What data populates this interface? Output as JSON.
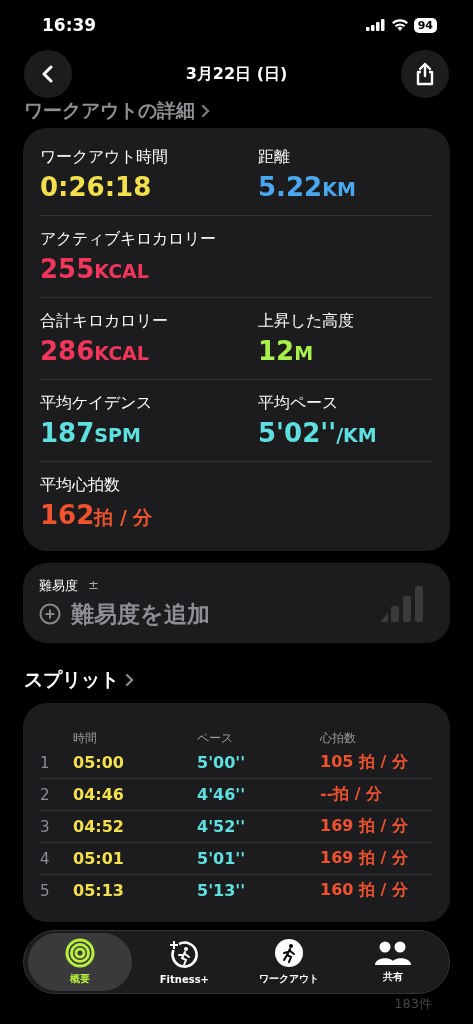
{
  "status_bar": {
    "time": "16:39",
    "battery": "94"
  },
  "nav": {
    "title": "3月22日 (日)"
  },
  "details": {
    "heading": "ワークアウトの詳細",
    "rows": [
      [
        {
          "label": "ワークアウト時間",
          "value": "0:26:18",
          "color": "#f4e04d"
        },
        {
          "label": "距離",
          "value": "5.22",
          "unit": "KM",
          "color": "#4aa8f0"
        }
      ],
      [
        {
          "label": "アクティブキロカロリー",
          "value": "255",
          "unit": "KCAL",
          "color": "#f0365a"
        }
      ],
      [
        {
          "label": "合計キロカロリー",
          "value": "286",
          "unit": "KCAL",
          "color": "#f0365a"
        },
        {
          "label": "上昇した高度",
          "value": "12",
          "unit": "M",
          "color": "#a8f04a"
        }
      ],
      [
        {
          "label": "平均ケイデンス",
          "value": "187",
          "unit": "SPM",
          "color": "#5ee0e0"
        },
        {
          "label": "平均ペース",
          "value": "5'02''",
          "unit": "/KM",
          "color": "#5ee0e0"
        }
      ],
      [
        {
          "label": "平均心拍数",
          "value": "162",
          "unit": "拍 / 分",
          "color": "#f2532f"
        }
      ]
    ]
  },
  "difficulty": {
    "label": "難易度",
    "mark": "±",
    "action": "難易度を追加"
  },
  "splits": {
    "heading": "スプリット",
    "columns": [
      "時間",
      "ペース",
      "心拍数"
    ],
    "rows": [
      {
        "index": "1",
        "time": "05:00",
        "pace": "5'00''",
        "heart_rate": "105 拍 / 分"
      },
      {
        "index": "2",
        "time": "04:46",
        "pace": "4'46''",
        "heart_rate": "--拍 / 分"
      },
      {
        "index": "3",
        "time": "04:52",
        "pace": "4'52''",
        "heart_rate": "169 拍 / 分"
      },
      {
        "index": "4",
        "time": "05:01",
        "pace": "5'01''",
        "heart_rate": "169 拍 / 分"
      },
      {
        "index": "5",
        "time": "05:13",
        "pace": "5'13''",
        "heart_rate": "160 拍 / 分"
      }
    ]
  },
  "tab_bar": [
    {
      "label": "概要",
      "kind": "summary",
      "selected": true
    },
    {
      "label": "Fitness+",
      "kind": "fitness",
      "selected": false
    },
    {
      "label": "ワークアウト",
      "kind": "workout",
      "selected": false
    },
    {
      "label": "共有",
      "kind": "sharing",
      "selected": false
    }
  ],
  "count": "183件"
}
